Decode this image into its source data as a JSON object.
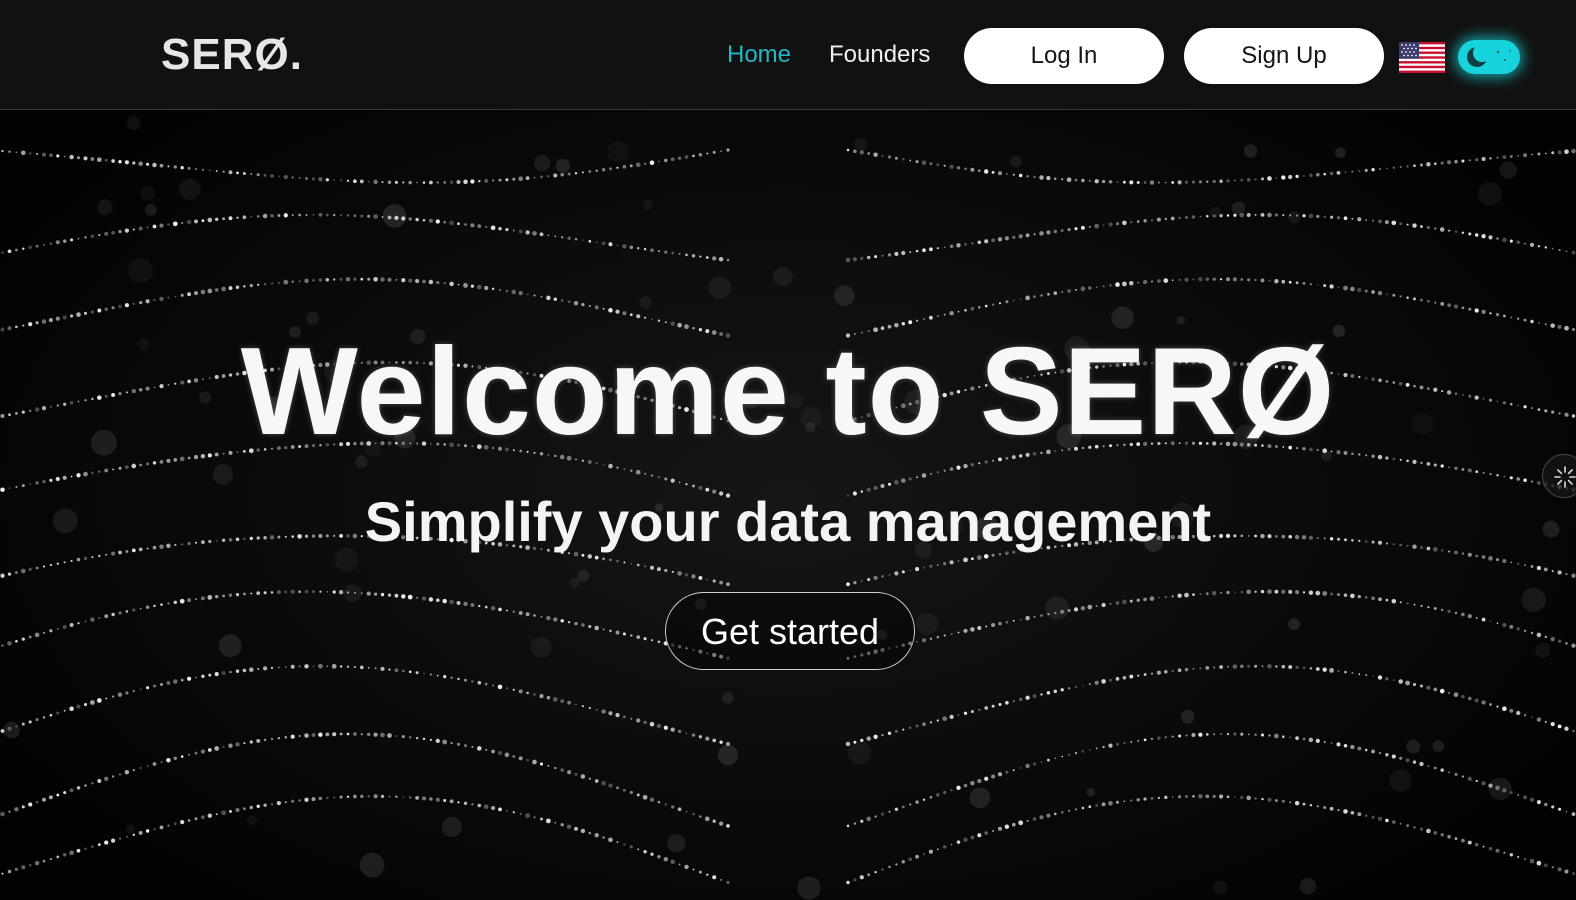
{
  "brand": {
    "logo_text": "SERØ."
  },
  "nav": {
    "home_label": "Home",
    "founders_label": "Founders",
    "active_color": "#1fb8c6",
    "link_color": "#f0f0f0"
  },
  "auth": {
    "login_label": "Log In",
    "signup_label": "Sign Up"
  },
  "language": {
    "flag_icon": "us-flag-icon"
  },
  "theme_toggle": {
    "icon": "moon-icon",
    "state": "dark",
    "accent": "#17d4dc"
  },
  "hero": {
    "title": "Welcome to SERØ",
    "subtitle": "Simplify your data management",
    "cta_label": "Get started"
  },
  "side_widget": {
    "icon": "loader-icon"
  }
}
